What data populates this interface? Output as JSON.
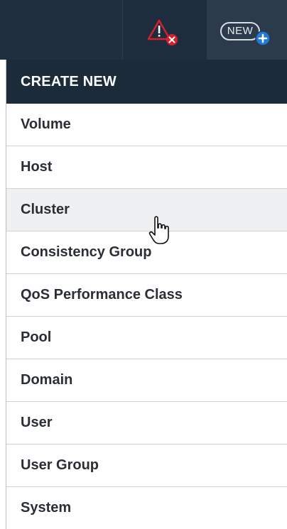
{
  "toolbar": {
    "alert_icon": "warning-error-icon",
    "new_button_label": "NEW",
    "new_button_icon": "plus-circle-icon"
  },
  "menu": {
    "header": "CREATE NEW",
    "hovered_item": "Cluster",
    "items": [
      {
        "label": "Volume"
      },
      {
        "label": "Host"
      },
      {
        "label": "Cluster"
      },
      {
        "label": "Consistency Group"
      },
      {
        "label": "QoS Performance Class"
      },
      {
        "label": "Pool"
      },
      {
        "label": "Domain"
      },
      {
        "label": "User"
      },
      {
        "label": "User Group"
      },
      {
        "label": "System"
      }
    ]
  },
  "colors": {
    "toolbar_bg": "#1c2c3c",
    "header_bg": "#1c2b3a",
    "warning_red": "#d6202d",
    "plus_blue": "#1f7ad9"
  }
}
